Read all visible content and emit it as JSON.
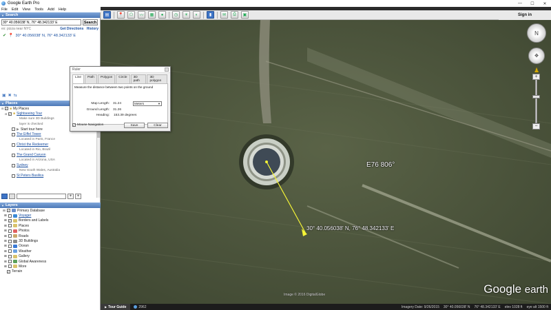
{
  "window": {
    "title": "Google Earth Pro",
    "minimize_icon": "—",
    "maximize_icon": "☐",
    "close_icon": "✕"
  },
  "menu": [
    "File",
    "Edit",
    "View",
    "Tools",
    "Add",
    "Help"
  ],
  "toolbar": {
    "sign_in": "Sign in",
    "icons": [
      "sidebar-icon",
      "placemark-icon",
      "polygon-icon",
      "path-icon",
      "overlay-icon",
      "record-tour-icon",
      "historical-imagery-icon",
      "sun-icon",
      "planets-icon",
      "ruler-icon",
      "email-icon",
      "print-icon",
      "maps-icon"
    ]
  },
  "search": {
    "header": "Search",
    "input_value": "30° 40.056038' N, 76° 48.342133' E",
    "button": "Search",
    "hint": "ex: pizza near NYC",
    "get_directions": "Get Directions",
    "history": "History",
    "result": "30° 40.056038' N, 76° 48.342133' E"
  },
  "places": {
    "header": "Places",
    "items": [
      {
        "type": "folder",
        "label": "My Places",
        "link": false
      },
      {
        "type": "folder",
        "label": "Sightseeing Tour",
        "link": true,
        "desc": "Make sure 3D Buildings"
      },
      {
        "type": "desc",
        "label": "layer is checked"
      },
      {
        "type": "item",
        "label": "Start tour here",
        "link": false
      },
      {
        "type": "item",
        "label": "The Eiffel Tower",
        "link": true,
        "desc": "Located in Paris, France"
      },
      {
        "type": "item",
        "label": "Christ the Redeemer",
        "link": true,
        "desc": "Located in Rio, Brazil"
      },
      {
        "type": "item",
        "label": "The Grand Canyon",
        "link": true,
        "desc": "Located in Arizona, USA"
      },
      {
        "type": "item",
        "label": "Sydney",
        "link": true,
        "desc": "New South Wales, Australia"
      },
      {
        "type": "item",
        "label": "St Peters Basilica",
        "link": true,
        "desc": ""
      }
    ]
  },
  "layers": {
    "header": "Layers",
    "items": [
      {
        "label": "Primary Database",
        "link": false,
        "checked": true,
        "color": "#6b8fc9",
        "indent": 0
      },
      {
        "label": "Voyager",
        "link": true,
        "checked": false,
        "color": "#3a8ad6",
        "indent": 1
      },
      {
        "label": "Borders and Labels",
        "link": false,
        "checked": true,
        "color": "#d9c36b",
        "indent": 1
      },
      {
        "label": "Places",
        "link": false,
        "checked": false,
        "color": "#d9c36b",
        "indent": 1
      },
      {
        "label": "Photos",
        "link": false,
        "checked": false,
        "color": "#e06060",
        "indent": 1
      },
      {
        "label": "Roads",
        "link": false,
        "checked": false,
        "color": "#c9a86b",
        "indent": 1
      },
      {
        "label": "3D Buildings",
        "link": false,
        "checked": false,
        "color": "#8a8a8a",
        "indent": 1
      },
      {
        "label": "Ocean",
        "link": false,
        "checked": false,
        "color": "#3a7ad6",
        "indent": 1
      },
      {
        "label": "Weather",
        "link": false,
        "checked": false,
        "color": "#6aa0e0",
        "indent": 1
      },
      {
        "label": "Gallery",
        "link": false,
        "checked": false,
        "color": "#d9c36b",
        "indent": 1
      },
      {
        "label": "Global Awareness",
        "link": false,
        "checked": false,
        "color": "#5aa05a",
        "indent": 1
      },
      {
        "label": "More",
        "link": false,
        "checked": false,
        "color": "#d9c36b",
        "indent": 1
      },
      {
        "label": "Terrain",
        "link": false,
        "checked": true,
        "color": "",
        "indent": 0
      }
    ]
  },
  "ruler": {
    "title": "Ruler",
    "tabs": [
      "Line",
      "Path",
      "Polygon",
      "Circle",
      "3D path",
      "3D polygon"
    ],
    "active_tab": "Line",
    "description": "Measure the distance between two points on the ground",
    "map_length_label": "Map Length:",
    "map_length_value": "31.24",
    "unit": "Meters",
    "ground_length_label": "Ground Length:",
    "ground_length_value": "31.26",
    "heading_label": "Heading:",
    "heading_value": "153.39 degrees",
    "mouse_navigation": "Mouse Navigation",
    "save": "Save",
    "clear": "Clear"
  },
  "map": {
    "label_longitude": "E76 806°",
    "label_point": "30° 40.056038' N, 76° 48.342133' E",
    "copyright": "Image © 2016 DigitalGlobe",
    "logo_word1": "Google",
    "logo_word2": "earth"
  },
  "status": {
    "tour_guide": "Tour Guide",
    "count": "2962",
    "imagery_date": "Imagery Date: 9/26/2015",
    "lat": "30° 40.056038' N",
    "lon": "76° 48.342133' E",
    "elev": "elev 1028 ft",
    "eye_alt": "eye alt 1500 ft"
  },
  "colors": {
    "measure_line": "#f5f536",
    "accent_blue": "#3d74c6",
    "link_blue": "#1a4fa0"
  }
}
